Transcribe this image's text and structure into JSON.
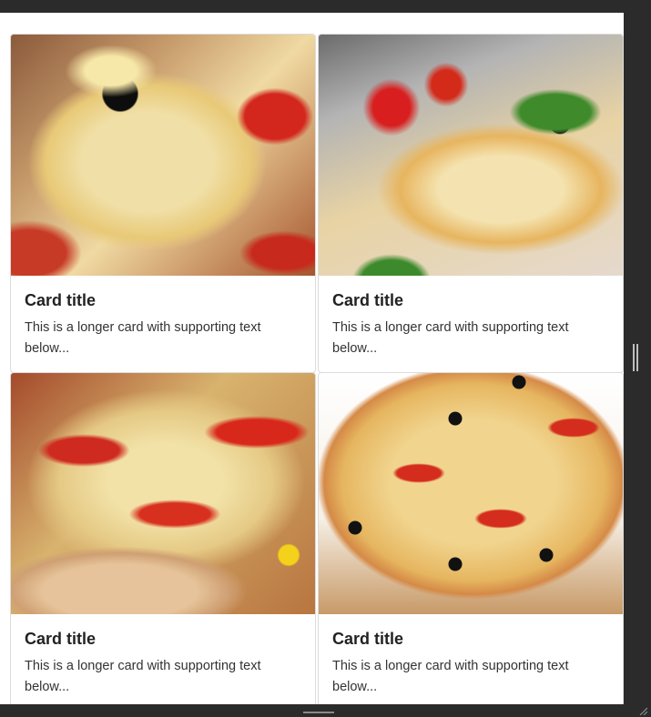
{
  "cards": [
    {
      "title": "Card title",
      "text": "This is a longer card with supporting text below...",
      "image": "pizza-slice-cheese-pull"
    },
    {
      "title": "Card title",
      "text": "This is a longer card with supporting text below...",
      "image": "pizza-slice-basil-tomato"
    },
    {
      "title": "Card title",
      "text": "This is a longer card with supporting text below...",
      "image": "pizza-closeup-peppers"
    },
    {
      "title": "Card title",
      "text": "This is a longer card with supporting text below...",
      "image": "pizza-whole-olives"
    }
  ],
  "icons": {
    "splitter": "vertical-drag-handle-icon",
    "resize": "resize-grip-icon",
    "bottom_handle": "horizontal-drag-handle-icon"
  }
}
